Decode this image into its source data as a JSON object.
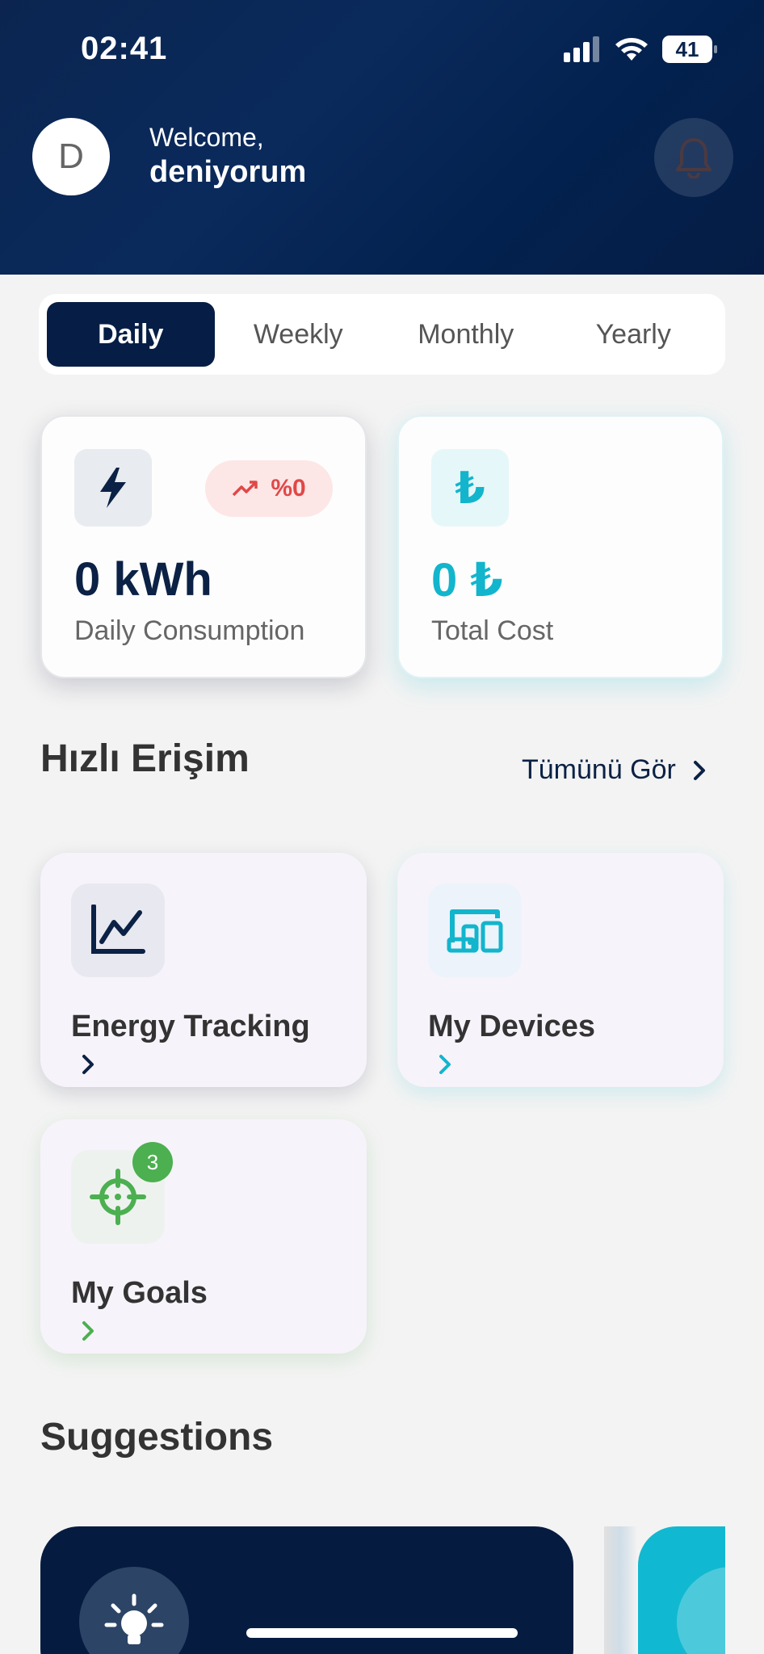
{
  "status_bar": {
    "time": "02:41",
    "battery": "41"
  },
  "header": {
    "avatar_initial": "D",
    "welcome": "Welcome,",
    "username": "deniyorum"
  },
  "period_tabs": [
    {
      "label": "Daily",
      "active": true
    },
    {
      "label": "Weekly",
      "active": false
    },
    {
      "label": "Monthly",
      "active": false
    },
    {
      "label": "Yearly",
      "active": false
    }
  ],
  "stats": {
    "consumption": {
      "value": "0 kWh",
      "label": "Daily Consumption",
      "trend": "%0"
    },
    "cost": {
      "icon_glyph": "₺",
      "value": "0 ₺",
      "label": "Total Cost"
    }
  },
  "quick_access": {
    "title": "Hızlı Erişim",
    "see_all": "Tümünü Gör",
    "items": [
      {
        "label": "Energy Tracking"
      },
      {
        "label": "My Devices"
      },
      {
        "label": "My Goals",
        "badge": "3"
      }
    ]
  },
  "suggestions": {
    "title": "Suggestions"
  },
  "colors": {
    "navy": "#061e45",
    "cyan": "#12b5cc",
    "red": "#e04848",
    "green": "#4caf50"
  }
}
